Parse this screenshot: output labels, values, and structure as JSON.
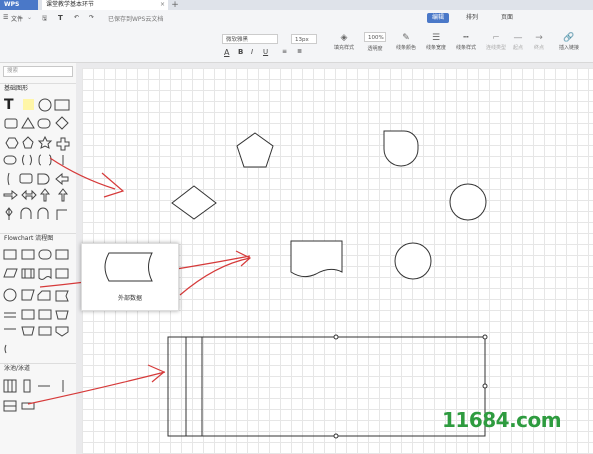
{
  "tabs": {
    "app": "WPS",
    "document": "课堂教学基本环节",
    "add": "+"
  },
  "toolbar": {
    "file_menu": "文件",
    "save_status": "已保存到WPS云文档",
    "modes": [
      "编辑",
      "排列",
      "页面"
    ],
    "font_name": "微软雅黑",
    "font_size": "13px",
    "zoom": "100%",
    "tools": [
      {
        "label": "填充样式",
        "icon": "paint-bucket-icon"
      },
      {
        "label": "透明度",
        "icon": "opacity-icon"
      },
      {
        "label": "线条颜色",
        "icon": "line-color-icon"
      },
      {
        "label": "线条宽度",
        "icon": "line-width-icon"
      },
      {
        "label": "线条样式",
        "icon": "line-style-icon"
      },
      {
        "label": "连线类型",
        "icon": "connector-type-icon"
      },
      {
        "label": "起点",
        "icon": "start-arrow-icon"
      },
      {
        "label": "终点",
        "icon": "end-arrow-icon"
      },
      {
        "label": "插入链接",
        "icon": "link-icon"
      }
    ]
  },
  "sidebar": {
    "search_placeholder": "搜索",
    "sections": [
      "基础图形",
      "Flowchart 流程图",
      "泳池/泳道"
    ]
  },
  "canvas": {
    "popup_label": "外部数据"
  },
  "watermark": "11684.com",
  "colors": {
    "accent": "#4a78c8",
    "annotation": "#d63a3a",
    "watermark": "#2e9b3f"
  }
}
